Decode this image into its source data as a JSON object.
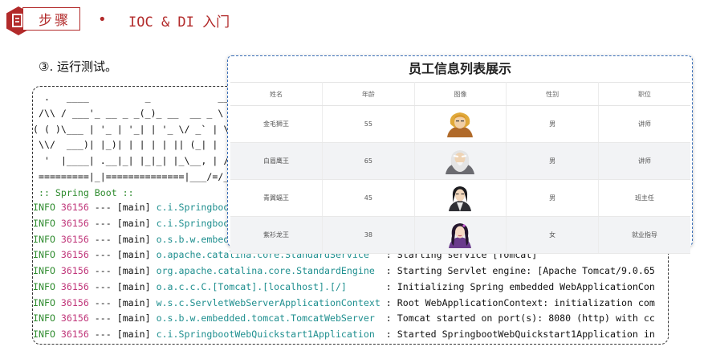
{
  "header": {
    "section_label": "步骤",
    "bullet": "•",
    "title": "IOC & DI 入门"
  },
  "step_text": "③. 运行测试。",
  "console": {
    "banner": [
      "  .   ____          _            __ _ _",
      " /\\\\ / ___'_ __ _ _(_)_ __  __ _ \\ \\ \\ \\",
      "( ( )\\___ | '_ | '_| | '_ \\/ _` | \\ \\ \\ \\",
      " \\\\/  ___)| |_)| | | | | || (_| |  ) ) ) )",
      "  '  |____| .__|_| |_|_| |_\\__, | / / / /",
      " =========|_|==============|___/=/_/_/_/"
    ],
    "spring_boot_tag": " :: Spring Boot ::",
    "log_lines": [
      {
        "level": "INFO",
        "pid": "36156",
        "sep": " --- [",
        "thread": "main",
        "close": "] ",
        "logger": "c.i.SpringbootWebQuickstart1Application ",
        "msg": ""
      },
      {
        "level": "INFO",
        "pid": "36156",
        "sep": " --- [",
        "thread": "main",
        "close": "] ",
        "logger": "c.i.SpringbootWebQuickstart1Application ",
        "msg": ""
      },
      {
        "level": "INFO",
        "pid": "36156",
        "sep": " --- [",
        "thread": "main",
        "close": "] ",
        "logger": "o.s.b.w.embedded.tomcat.TomcatWebServer  ",
        "msg": ""
      },
      {
        "level": "INFO",
        "pid": "36156",
        "sep": " --- [",
        "thread": "main",
        "close": "] ",
        "logger": "o.apache.catalina.core.StandardService   ",
        "msg": ": Starting service [Tomcat]"
      },
      {
        "level": "INFO",
        "pid": "36156",
        "sep": " --- [",
        "thread": "main",
        "close": "] ",
        "logger": "org.apache.catalina.core.StandardEngine  ",
        "msg": ": Starting Servlet engine: [Apache Tomcat/9.0.65"
      },
      {
        "level": "INFO",
        "pid": "36156",
        "sep": " --- [",
        "thread": "main",
        "close": "] ",
        "logger": "o.a.c.c.C.[Tomcat].[localhost].[/]       ",
        "msg": ": Initializing Spring embedded WebApplicationCon"
      },
      {
        "level": "INFO",
        "pid": "36156",
        "sep": " --- [",
        "thread": "main",
        "close": "] ",
        "logger": "w.s.c.ServletWebServerApplicationContext ",
        "msg": ": Root WebApplicationContext: initialization com"
      },
      {
        "level": "INFO",
        "pid": "36156",
        "sep": " --- [",
        "thread": "main",
        "close": "] ",
        "logger": "o.s.b.w.embedded.tomcat.TomcatWebServer  ",
        "msg": ": Tomcat started on port(s): 8080 (http) with cc"
      },
      {
        "level": "INFO",
        "pid": "36156",
        "sep": " --- [",
        "thread": "main",
        "close": "] ",
        "logger": "c.i.SpringbootWebQuickstart1Application  ",
        "msg": ": Started SpringbootWebQuickstart1Application in"
      }
    ]
  },
  "employee_table": {
    "title": "员工信息列表展示",
    "columns": [
      "姓名",
      "年龄",
      "图像",
      "性别",
      "职位"
    ],
    "rows": [
      {
        "name": "金毛狮王",
        "age": "55",
        "avatar": "golden-lion-avatar",
        "gender": "男",
        "job": "讲师"
      },
      {
        "name": "白眉鹰王",
        "age": "65",
        "avatar": "white-eyebrow-avatar",
        "gender": "男",
        "job": "讲师"
      },
      {
        "name": "青翼蝠王",
        "age": "45",
        "avatar": "green-wing-avatar",
        "gender": "男",
        "job": "班主任"
      },
      {
        "name": "紫衫龙王",
        "age": "38",
        "avatar": "purple-dragon-avatar",
        "gender": "女",
        "job": "就业指导"
      }
    ]
  },
  "colors": {
    "accent": "#b22a2a",
    "log_level": "#2e8b2e",
    "pid": "#c0367a",
    "logger": "#1f8f8f",
    "overlay_border": "#3a6fb8"
  }
}
